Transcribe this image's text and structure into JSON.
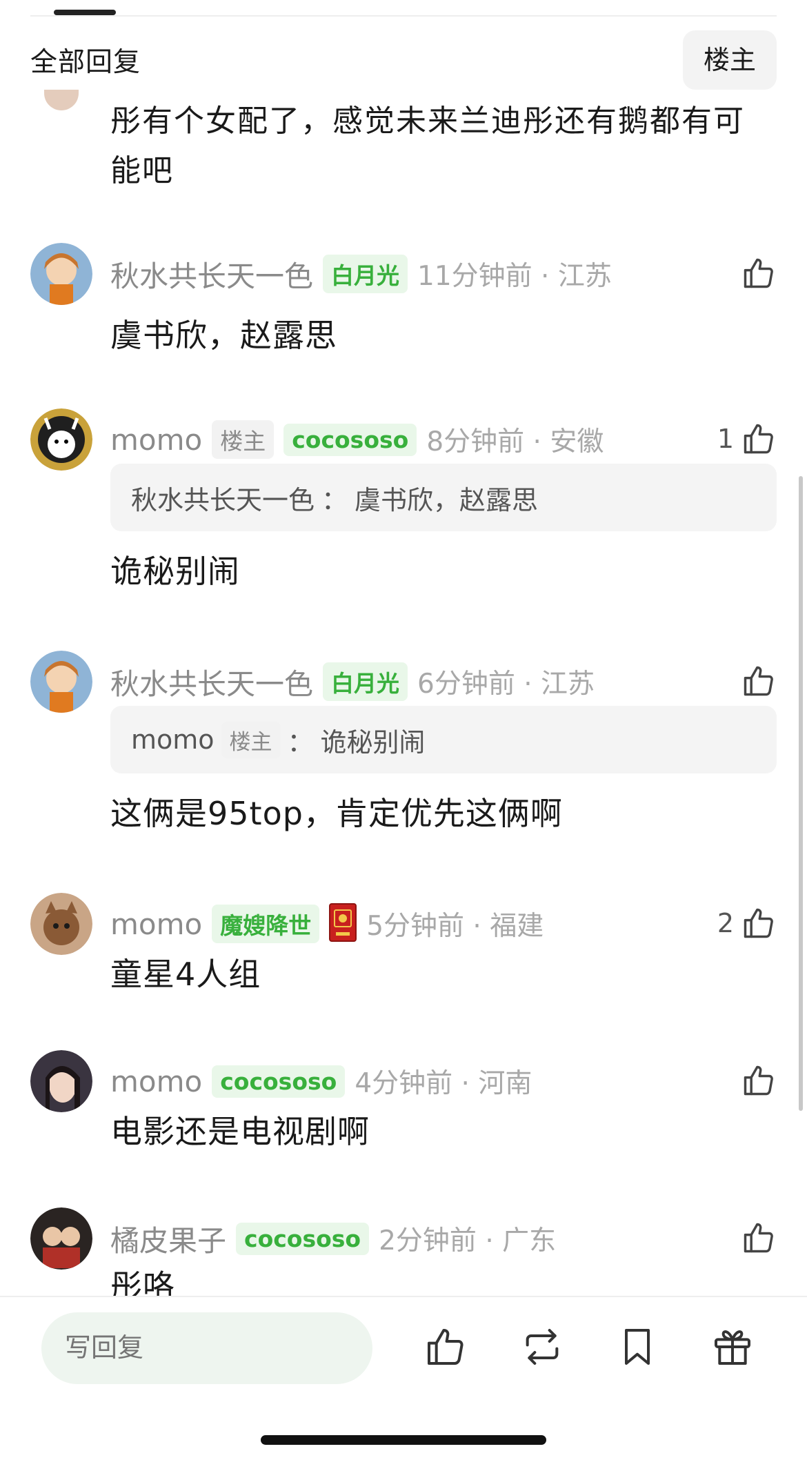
{
  "header": {
    "title": "全部回复",
    "owner_filter": "楼主"
  },
  "partial_comment": {
    "text": "彤有个女配了，感觉未来兰迪彤还有鹅都有可能吧"
  },
  "comments": [
    {
      "username": "秋水共长天一色",
      "tags": [
        "白月光"
      ],
      "time": "11分钟前 · 江苏",
      "likes": "",
      "text": "虞书欣，赵露思"
    },
    {
      "username": "momo",
      "owner_tag": "楼主",
      "tags": [
        "cocososo"
      ],
      "time": "8分钟前 · 安徽",
      "likes": "1",
      "quote": {
        "author": "秋水共长天一色",
        "sep": "：",
        "text": "虞书欣，赵露思"
      },
      "text": "诡秘别闹"
    },
    {
      "username": "秋水共长天一色",
      "tags": [
        "白月光"
      ],
      "time": "6分钟前 · 江苏",
      "likes": "",
      "quote": {
        "author": "momo",
        "owner_tag": "楼主",
        "sep": "：",
        "text": "诡秘别闹"
      },
      "text": "这俩是95top，肯定优先这俩啊"
    },
    {
      "username": "momo",
      "tags": [
        "魔嫂降世"
      ],
      "badge_icon": "red-envelope-icon",
      "time": "5分钟前 · 福建",
      "likes": "2",
      "text": "童星4人组"
    },
    {
      "username": "momo",
      "tags": [
        "cocososo"
      ],
      "time": "4分钟前 · 河南",
      "likes": "",
      "text": "电影还是电视剧啊"
    },
    {
      "username": "橘皮果子",
      "tags": [
        "cocososo"
      ],
      "time": "2分钟前 · 广东",
      "likes": "",
      "text": "彤咯"
    }
  ],
  "bottom_bar": {
    "reply_placeholder": "写回复",
    "actions": [
      "thumb-up-icon",
      "repost-icon",
      "bookmark-icon",
      "gift-icon"
    ]
  },
  "colors": {
    "accent_green": "#38b03c",
    "tag_green_bg": "#e9f7e9",
    "meta_gray": "#8a8a8a"
  }
}
